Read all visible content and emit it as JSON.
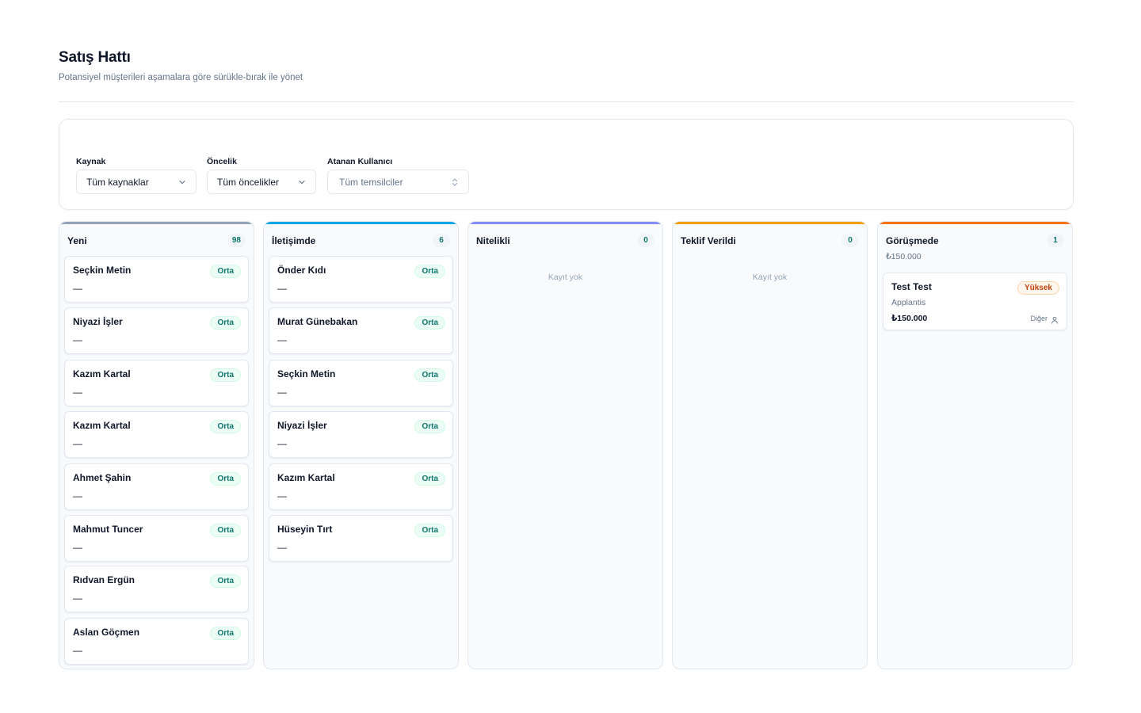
{
  "page": {
    "title": "Satış Hattı",
    "subtitle": "Potansiyel müşterileri aşamalara göre sürükle-bırak ile yönet"
  },
  "filters": {
    "source": {
      "label": "Kaynak",
      "value": "Tüm kaynaklar"
    },
    "priority": {
      "label": "Öncelik",
      "value": "Tüm öncelikler"
    },
    "assignee": {
      "label": "Atanan Kullanıcı",
      "placeholder": "Tüm temsilciler"
    }
  },
  "colors": {
    "yeni": "#94a3b8",
    "iletisimde": "#0ea5e9",
    "nitelikli": "#818cf8",
    "teklif": "#f59e0b",
    "gorusmede": "#f97316"
  },
  "columns": {
    "yeni": {
      "title": "Yeni",
      "count": "98",
      "cards": [
        {
          "name": "Seçkin Metin",
          "priority": "Orta",
          "detail": "—"
        },
        {
          "name": "Niyazi İşler",
          "priority": "Orta",
          "detail": "—"
        },
        {
          "name": "Kazım Kartal",
          "priority": "Orta",
          "detail": "—"
        },
        {
          "name": "Kazım Kartal",
          "priority": "Orta",
          "detail": "—"
        },
        {
          "name": "Ahmet Şahin",
          "priority": "Orta",
          "detail": "—"
        },
        {
          "name": "Mahmut Tuncer",
          "priority": "Orta",
          "detail": "—"
        },
        {
          "name": "Rıdvan Ergün",
          "priority": "Orta",
          "detail": "—"
        },
        {
          "name": "Aslan Göçmen",
          "priority": "Orta",
          "detail": "—"
        }
      ]
    },
    "iletisimde": {
      "title": "İletişimde",
      "count": "6",
      "cards": [
        {
          "name": "Önder Kıdı",
          "priority": "Orta",
          "detail": "—"
        },
        {
          "name": "Murat Günebakan",
          "priority": "Orta",
          "detail": "—"
        },
        {
          "name": "Seçkin Metin",
          "priority": "Orta",
          "detail": "—"
        },
        {
          "name": "Niyazi İşler",
          "priority": "Orta",
          "detail": "—"
        },
        {
          "name": "Kazım Kartal",
          "priority": "Orta",
          "detail": "—"
        },
        {
          "name": "Hüseyin Tırt",
          "priority": "Orta",
          "detail": "—"
        }
      ]
    },
    "nitelikli": {
      "title": "Nitelikli",
      "count": "0",
      "empty": "Kayıt yok"
    },
    "teklif": {
      "title": "Teklif Verildi",
      "count": "0",
      "empty": "Kayıt yok"
    },
    "gorusmede": {
      "title": "Görüşmede",
      "count": "1",
      "total": "₺150.000",
      "cards": [
        {
          "name": "Test Test",
          "priority": "Yüksek",
          "company": "Applantis",
          "value": "₺150.000",
          "source": "Diğer"
        }
      ]
    }
  }
}
